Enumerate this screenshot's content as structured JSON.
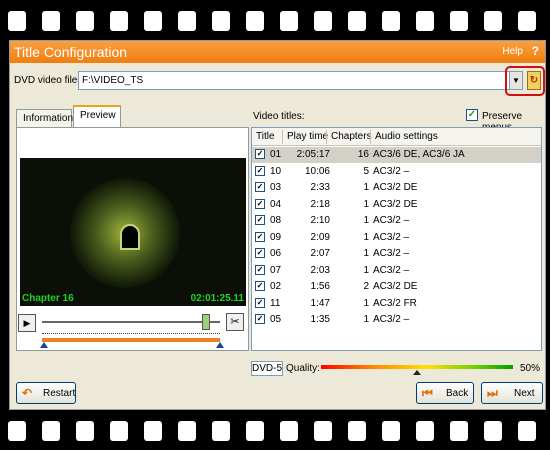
{
  "window": {
    "title": "Title Configuration",
    "help_label": "Help",
    "help_icon": "?"
  },
  "source": {
    "label": "DVD video files:",
    "path": "F:\\VIDEO_TS",
    "dropdown_icon": "chevron-down-icon",
    "refresh_icon": "refresh-icon"
  },
  "tabs": [
    {
      "label": "Information",
      "selected": false
    },
    {
      "label": "Preview",
      "selected": true
    }
  ],
  "preview": {
    "chapter": "Chapter 16",
    "timecode": "02:01:25.11",
    "seek_position": 0.93
  },
  "video_titles": {
    "label": "Video titles:",
    "preserve_menus_label": "Preserve menus",
    "preserve_menus_checked": true,
    "columns": [
      "Title",
      "Play time",
      "Chapters",
      "Audio settings"
    ],
    "rows": [
      {
        "checked": true,
        "title": "01",
        "time": "2:05:17",
        "chapters": "16",
        "audio": "AC3/6 DE, AC3/6 JA",
        "selected": true
      },
      {
        "checked": true,
        "title": "10",
        "time": "10:06",
        "chapters": "5",
        "audio": "AC3/2 –"
      },
      {
        "checked": true,
        "title": "03",
        "time": "2:33",
        "chapters": "1",
        "audio": "AC3/2 DE"
      },
      {
        "checked": true,
        "title": "04",
        "time": "2:18",
        "chapters": "1",
        "audio": "AC3/2 DE"
      },
      {
        "checked": true,
        "title": "08",
        "time": "2:10",
        "chapters": "1",
        "audio": "AC3/2 –"
      },
      {
        "checked": true,
        "title": "09",
        "time": "2:09",
        "chapters": "1",
        "audio": "AC3/2 –"
      },
      {
        "checked": true,
        "title": "06",
        "time": "2:07",
        "chapters": "1",
        "audio": "AC3/2 –"
      },
      {
        "checked": true,
        "title": "07",
        "time": "2:03",
        "chapters": "1",
        "audio": "AC3/2 –"
      },
      {
        "checked": true,
        "title": "02",
        "time": "1:56",
        "chapters": "2",
        "audio": "AC3/2 DE"
      },
      {
        "checked": true,
        "title": "11",
        "time": "1:47",
        "chapters": "1",
        "audio": "AC3/2 FR"
      },
      {
        "checked": true,
        "title": "05",
        "time": "1:35",
        "chapters": "1",
        "audio": "AC3/2 –"
      }
    ]
  },
  "output": {
    "disc_type": "DVD-5",
    "quality_label": "Quality:",
    "quality_value": "50%",
    "quality_fraction": 0.5
  },
  "buttons": {
    "restart": "Restart",
    "back": "Back",
    "next": "Next"
  },
  "colors": {
    "titlebar": "#f07e10",
    "timecode_green": "#22d022",
    "highlight_ring": "#d01010"
  }
}
